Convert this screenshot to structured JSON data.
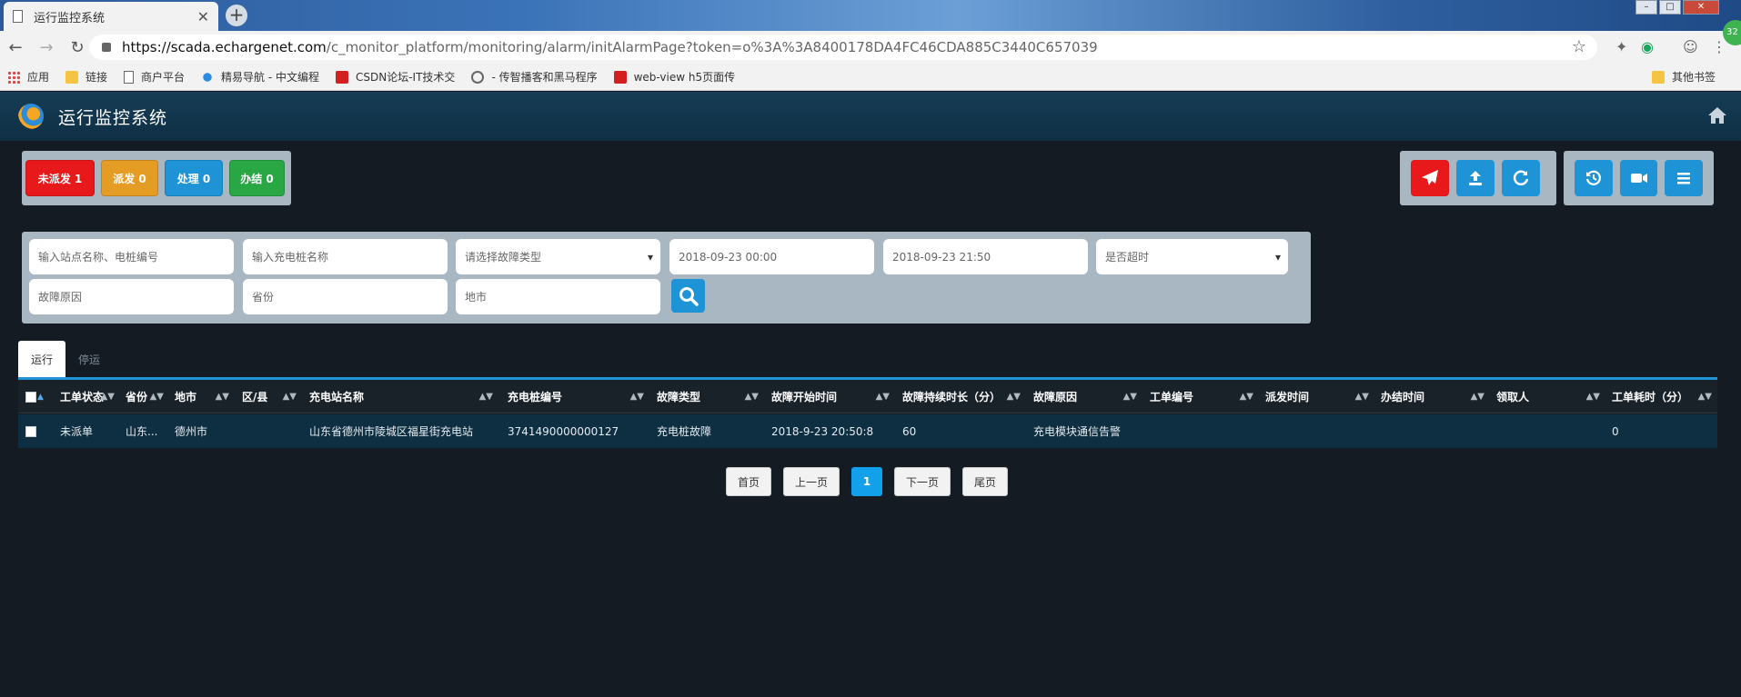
{
  "browser": {
    "tab_title": "运行监控系统",
    "url_host": "https://scada.echargenet.com",
    "url_path": "/c_monitor_platform/monitoring/alarm/initAlarmPage?token=o%3A%3A8400178DA4FC46CDA885C3440C657039",
    "bookmarks": [
      "应用",
      "链接",
      "商户平台",
      "精易导航 - 中文编程",
      "CSDN论坛-IT技术交",
      "- 传智播客和黑马程序",
      "web-view h5页面传"
    ],
    "bookmark_other": "其他书签",
    "profile_badge": "32"
  },
  "app": {
    "title": "运行监控系统"
  },
  "status": {
    "undispatched": "未派发 1",
    "dispatched": "派发 0",
    "processing": "处理 0",
    "closed": "办结 0"
  },
  "filters": {
    "station_placeholder": "输入站点名称、电桩编号",
    "pile_placeholder": "输入充电桩名称",
    "fault_type_placeholder": "请选择故障类型",
    "start_time": "2018-09-23 00:00",
    "end_time": "2018-09-23 21:50",
    "timeout_placeholder": "是否超时",
    "fault_reason_placeholder": "故障原因",
    "province_placeholder": "省份",
    "city_placeholder": "地市"
  },
  "tabs": [
    "运行",
    "停运"
  ],
  "table": {
    "headers": [
      "工单状态",
      "省份",
      "地市",
      "区/县",
      "充电站名称",
      "充电桩编号",
      "故障类型",
      "故障开始时间",
      "故障持续时长（分）",
      "故障原因",
      "工单编号",
      "派发时间",
      "办结时间",
      "领取人",
      "工单耗时（分）"
    ],
    "rows": [
      {
        "status": "未派单",
        "province": "山东...",
        "city": "德州市",
        "district": "",
        "station": "山东省德州市陵城区福星街充电站",
        "pile": "3741490000000127",
        "fault_type": "充电桩故障",
        "start": "2018-9-23 20:50:8",
        "duration": "60",
        "reason": "充电模块通信告警",
        "order_no": "",
        "dispatch_time": "",
        "close_time": "",
        "assignee": "",
        "cost": "0"
      }
    ]
  },
  "pager": {
    "first": "首页",
    "prev": "上一页",
    "current": "1",
    "next": "下一页",
    "last": "尾页"
  }
}
